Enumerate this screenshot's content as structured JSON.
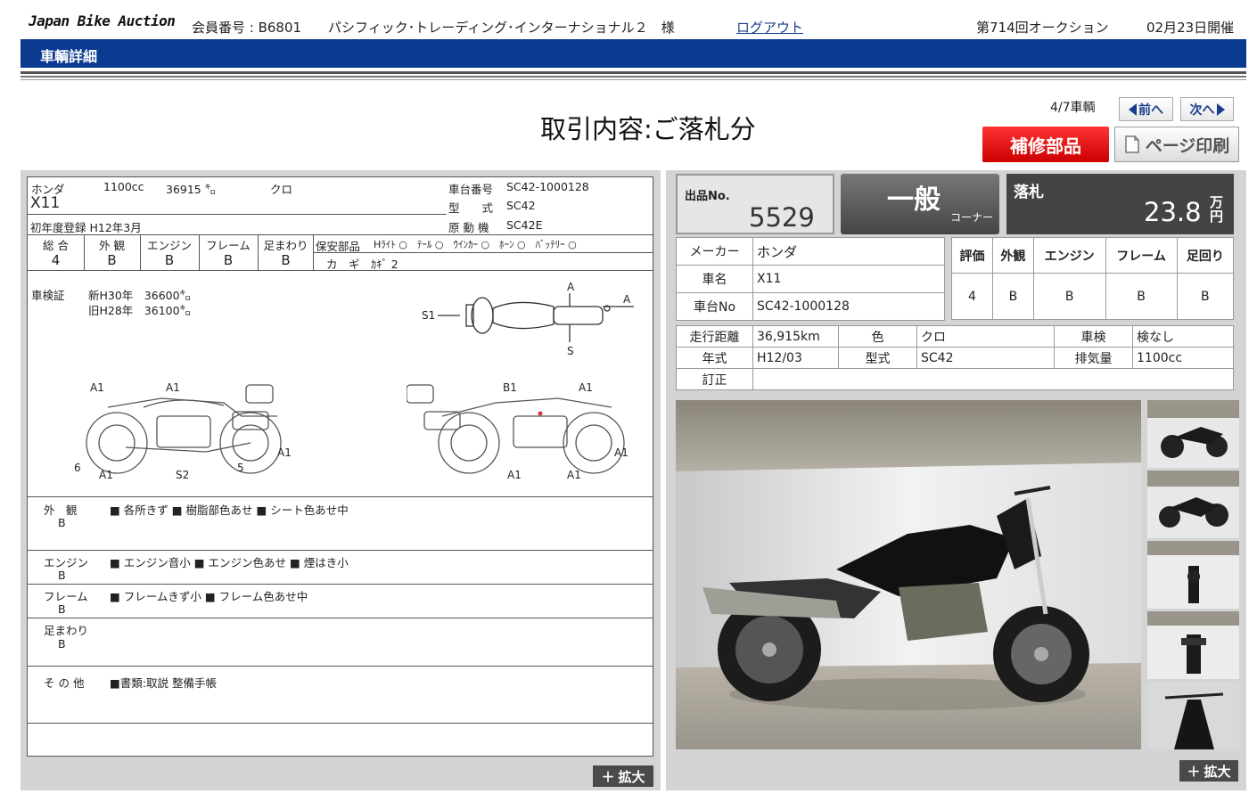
{
  "header": {
    "logo": "Japan Bike Auction",
    "member_label": "会員番号 : B6801",
    "member_name": "パシフィック･トレーディング･インターナショナル２　様",
    "logout": "ログアウト",
    "auction_no": "第714回オークション",
    "date": "02月23日開催"
  },
  "section_title": "車輌詳細",
  "page_title": "取引内容:ご落札分",
  "nav": {
    "count": "4/7車輌",
    "prev": "前へ",
    "next": "次へ"
  },
  "buttons": {
    "repair": "補修部品",
    "print": "ページ印刷",
    "expand": "拡大"
  },
  "sheet": {
    "maker": "ホンダ",
    "cc": "1100cc",
    "km": "36915 ㌔",
    "color": "クロ",
    "frame_label": "車台番号",
    "frame": "SC42-1000128",
    "model": "X11",
    "type_label": "型　　式",
    "type": "SC42",
    "first_reg": "初年度登録 H12年3月",
    "engine_label": "原 動 機",
    "engine": "SC42E",
    "grade_headers": [
      "総 合",
      "外 観",
      "エンジン",
      "フレーム",
      "足まわり"
    ],
    "grades": [
      "4",
      "B",
      "B",
      "B",
      "B"
    ],
    "parts_label": "保安部品",
    "parts": "Hﾗｲﾄ ○　ﾃｰﾙ ○　ｳｲﾝｶｰ ○　ﾎｰﾝ ○　ﾊﾞｯﾃﾘｰ ○",
    "keys": "カ　ギ　ｶｷﾞ 2",
    "inspection_label": "車検証",
    "insp1": "新H30年　36600㌔",
    "insp2": "旧H28年　36100㌔",
    "diagram_labels": {
      "A": "A",
      "S": "S",
      "S1": "S1",
      "A1": "A1",
      "B1": "B1",
      "S2": "S2",
      "n6": "6",
      "n5": "5"
    },
    "notes": [
      {
        "label": "外　観",
        "grade": "B",
        "text": "■ 各所きず ■ 樹脂部色あせ ■ シート色あせ中"
      },
      {
        "label": "エンジン",
        "grade": "B",
        "text": "■ エンジン音小 ■ エンジン色あせ ■ 煙はき小"
      },
      {
        "label": "フレーム",
        "grade": "B",
        "text": "■ フレームきず小 ■ フレーム色あせ中"
      },
      {
        "label": "足まわり",
        "grade": "B",
        "text": ""
      },
      {
        "label": "そ の 他",
        "grade": "",
        "text": "■書類:取説 整備手帳"
      }
    ]
  },
  "summary": {
    "lot_label": "出品No.",
    "lot": "5529",
    "corner": "一般",
    "corner_sub": "コーナー",
    "price_label": "落札",
    "price": "23.8",
    "price_unit_1": "万",
    "price_unit_2": "円"
  },
  "specs": {
    "maker_label": "メーカー",
    "maker": "ホンダ",
    "name_label": "車名",
    "name": "X11",
    "frame_label": "車台No",
    "frame": "SC42-1000128",
    "grade_headers": [
      "評価",
      "外観",
      "エンジン",
      "フレーム",
      "足回り"
    ],
    "grades": [
      "4",
      "B",
      "B",
      "B",
      "B"
    ],
    "mileage_label": "走行距離",
    "mileage": "36,915km",
    "color_label": "色",
    "color": "クロ",
    "inspect_label": "車検",
    "inspect": "検なし",
    "year_label": "年式",
    "year": "H12/03",
    "type_label": "型式",
    "type": "SC42",
    "disp_label": "排気量",
    "disp": "1100cc",
    "correction_label": "訂正",
    "correction": ""
  }
}
